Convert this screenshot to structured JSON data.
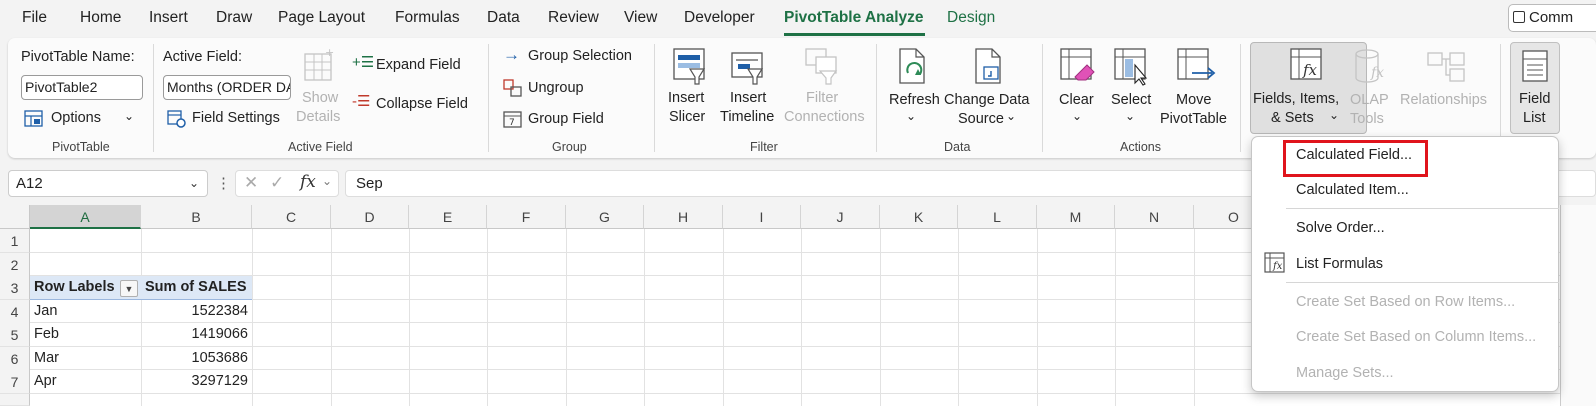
{
  "menubar": {
    "tabs": [
      "File",
      "Home",
      "Insert",
      "Draw",
      "Page Layout",
      "Formulas",
      "Data",
      "Review",
      "View",
      "Developer",
      "PivotTable Analyze",
      "Design"
    ],
    "active_tab": "PivotTable Analyze",
    "comments_label": "Comm"
  },
  "ribbon": {
    "pivottable": {
      "name_label": "PivotTable Name:",
      "name_value": "PivotTable2",
      "options_label": "Options",
      "group_label": "PivotTable"
    },
    "active_field": {
      "label": "Active Field:",
      "value": "Months (ORDER DA",
      "field_settings": "Field Settings",
      "show_details_1": "Show",
      "show_details_2": "Details",
      "expand_field": "Expand Field",
      "collapse_field": "Collapse Field",
      "group_label": "Active Field"
    },
    "group": {
      "group_selection": "Group Selection",
      "ungroup": "Ungroup",
      "group_field": "Group Field",
      "group_label": "Group"
    },
    "filter": {
      "insert_slicer_1": "Insert",
      "insert_slicer_2": "Slicer",
      "insert_timeline_1": "Insert",
      "insert_timeline_2": "Timeline",
      "filter_connections_1": "Filter",
      "filter_connections_2": "Connections",
      "group_label": "Filter"
    },
    "data": {
      "refresh": "Refresh",
      "change_source_1": "Change Data",
      "change_source_2": "Source",
      "group_label": "Data"
    },
    "actions": {
      "clear": "Clear",
      "select": "Select",
      "move_1": "Move",
      "move_2": "PivotTable",
      "group_label": "Actions"
    },
    "calculations": {
      "fields_items_1": "Fields, Items,",
      "fields_items_2": "& Sets",
      "olap_1": "OLAP",
      "olap_2": "Tools",
      "relationships": "Relationships"
    },
    "show": {
      "field_list_1": "Field",
      "field_list_2": "List"
    }
  },
  "formula_bar": {
    "name_box": "A12",
    "fx": "fx",
    "content": "Sep"
  },
  "grid": {
    "columns": [
      "A",
      "B",
      "C",
      "D",
      "E",
      "F",
      "G",
      "H",
      "I",
      "J",
      "K",
      "L",
      "M",
      "N",
      "O"
    ],
    "rows": [
      "1",
      "2",
      "3",
      "4",
      "5",
      "6",
      "7"
    ],
    "header_row_label": "Row Labels",
    "header_value_label": "Sum of SALES",
    "data": [
      {
        "month": "Jan",
        "sales": "1522384"
      },
      {
        "month": "Feb",
        "sales": "1419066"
      },
      {
        "month": "Mar",
        "sales": "1053686"
      },
      {
        "month": "Apr",
        "sales": "3297129"
      }
    ]
  },
  "dropdown": {
    "calculated_field": "Calculated Field...",
    "calculated_item": "Calculated Item...",
    "solve_order": "Solve Order...",
    "list_formulas": "List Formulas",
    "set_row": "Create Set Based on Row Items...",
    "set_column": "Create Set Based on Column Items...",
    "manage_sets": "Manage Sets..."
  },
  "colors": {
    "accent": "#1e7145",
    "highlight": "#e0141c",
    "pivot_header": "#dde8f6"
  }
}
